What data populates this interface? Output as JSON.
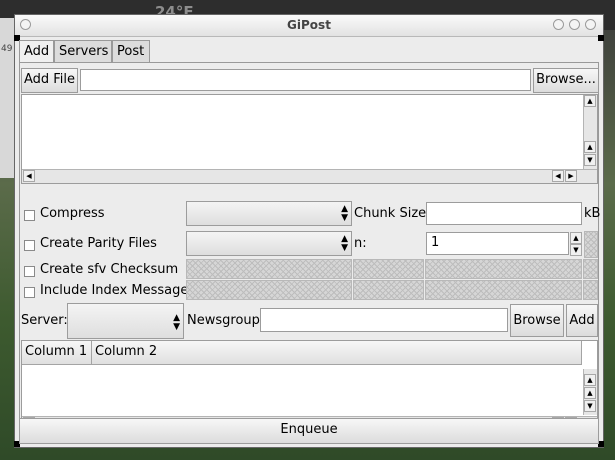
{
  "background": {
    "temperature_text": "24°F",
    "left_label": "49"
  },
  "window": {
    "title": "GiPost"
  },
  "tabs": [
    {
      "label": "Add"
    },
    {
      "label": "Servers"
    },
    {
      "label": "Post"
    }
  ],
  "add_file": {
    "button_label": "Add File",
    "path_value": "",
    "browse_label": "Browse..."
  },
  "options": {
    "compress_label": "Compress",
    "chunk_size_label": "Chunk Size",
    "chunk_size_value": "",
    "chunk_unit": "kB",
    "parity_label": "Create Parity Files",
    "n_label": "n:",
    "n_value": "1",
    "sfv_label": "Create sfv Checksum",
    "index_label": "Include Index Message"
  },
  "server_row": {
    "server_label": "Server:",
    "newsgroup_label": "Newsgroup",
    "newsgroup_value": "",
    "browse_label": "Browse",
    "add_label": "Add"
  },
  "table": {
    "columns": [
      "Column 1",
      "Column 2"
    ]
  },
  "enqueue_label": "Enqueue"
}
